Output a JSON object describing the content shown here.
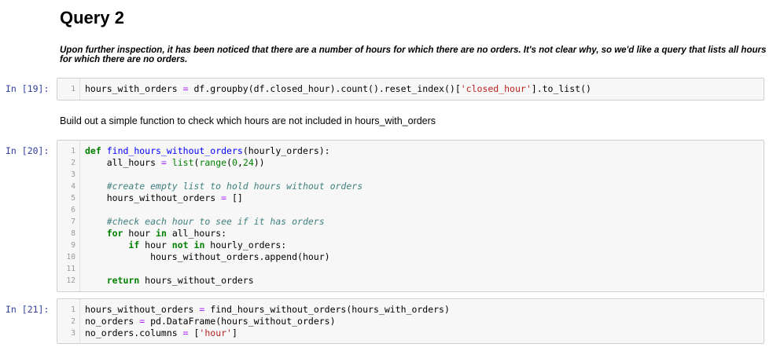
{
  "markdown": {
    "title": "Query 2",
    "intro": "Upon further inspection, it has been noticed that there are a number of hours for which there are no orders. It's not clear why, so we'd like a query that lists all hours for which there are no orders.",
    "explain": "Build out a simple function to check which hours are not included in hours_with_orders"
  },
  "cells": [
    {
      "prompt": "In [19]:",
      "lines": [
        [
          {
            "t": "hours_with_orders "
          },
          {
            "t": "=",
            "c": "op"
          },
          {
            "t": " df.groupby(df.closed_hour).count().reset_index()["
          },
          {
            "t": "'closed_hour'",
            "c": "st"
          },
          {
            "t": "].to_list()"
          }
        ]
      ]
    },
    {
      "prompt": "In [20]:",
      "lines": [
        [
          {
            "t": "def",
            "c": "kw"
          },
          {
            "t": " "
          },
          {
            "t": "find_hours_without_orders",
            "c": "fn"
          },
          {
            "t": "(hourly_orders):"
          }
        ],
        [
          {
            "t": "    all_hours "
          },
          {
            "t": "=",
            "c": "op"
          },
          {
            "t": " "
          },
          {
            "t": "list",
            "c": "nb"
          },
          {
            "t": "("
          },
          {
            "t": "range",
            "c": "nb"
          },
          {
            "t": "("
          },
          {
            "t": "0",
            "c": "num"
          },
          {
            "t": ","
          },
          {
            "t": "24",
            "c": "num"
          },
          {
            "t": "))"
          }
        ],
        [],
        [
          {
            "t": "    "
          },
          {
            "t": "#create empty list to hold hours without orders",
            "c": "cm"
          }
        ],
        [
          {
            "t": "    hours_without_orders "
          },
          {
            "t": "=",
            "c": "op"
          },
          {
            "t": " []"
          }
        ],
        [],
        [
          {
            "t": "    "
          },
          {
            "t": "#check each hour to see if it has orders",
            "c": "cm"
          }
        ],
        [
          {
            "t": "    "
          },
          {
            "t": "for",
            "c": "kw"
          },
          {
            "t": " hour "
          },
          {
            "t": "in",
            "c": "kw"
          },
          {
            "t": " all_hours:"
          }
        ],
        [
          {
            "t": "        "
          },
          {
            "t": "if",
            "c": "kw"
          },
          {
            "t": " hour "
          },
          {
            "t": "not",
            "c": "kw"
          },
          {
            "t": " "
          },
          {
            "t": "in",
            "c": "kw"
          },
          {
            "t": " hourly_orders:"
          }
        ],
        [
          {
            "t": "            hours_without_orders.append(hour)"
          }
        ],
        [],
        [
          {
            "t": "    "
          },
          {
            "t": "return",
            "c": "kw"
          },
          {
            "t": " hours_without_orders"
          }
        ]
      ]
    },
    {
      "prompt": "In [21]:",
      "lines": [
        [
          {
            "t": "hours_without_orders "
          },
          {
            "t": "=",
            "c": "op"
          },
          {
            "t": " find_hours_without_orders(hours_with_orders)"
          }
        ],
        [
          {
            "t": "no_orders "
          },
          {
            "t": "=",
            "c": "op"
          },
          {
            "t": " pd.DataFrame(hours_without_orders)"
          }
        ],
        [
          {
            "t": "no_orders.columns "
          },
          {
            "t": "=",
            "c": "op"
          },
          {
            "t": " ["
          },
          {
            "t": "'hour'",
            "c": "st"
          },
          {
            "t": "]"
          }
        ]
      ]
    }
  ]
}
